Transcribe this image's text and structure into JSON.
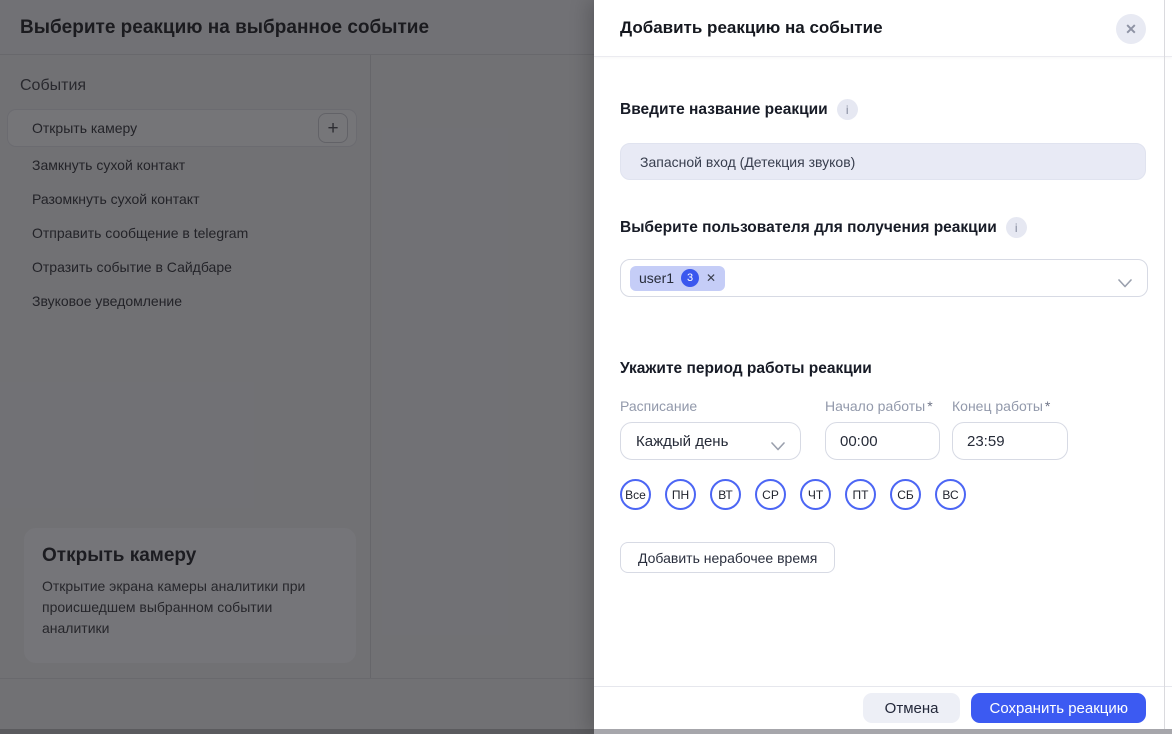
{
  "background": {
    "title": "Выберите реакцию на выбранное событие",
    "events_label": "События",
    "plus_icon": "+",
    "events": [
      "Открыть камеру",
      "Замкнуть сухой контакт",
      "Разомкнуть сухой контакт",
      "Отправить сообщение в telegram",
      "Отразить событие в Сайдбаре",
      "Звуковое уведомление"
    ],
    "selected_event_card": {
      "title": "Открыть камеру",
      "description": "Открытие экрана камеры аналитики при происшедшем выбранном событии аналитики"
    }
  },
  "panel": {
    "title": "Добавить реакцию на событие",
    "close_icon": "✕",
    "name_section": {
      "label": "Введите название реакции",
      "info_icon": "i",
      "value": "Запасной вход (Детекция звуков)"
    },
    "user_section": {
      "label": "Выберите пользователя для получения реакции",
      "info_icon": "i",
      "chip": {
        "name": "user1",
        "count": "3",
        "remove_icon": "✕"
      }
    },
    "period_section": {
      "label": "Укажите период работы реакции",
      "schedule": {
        "label": "Расписание",
        "value": "Каждый день"
      },
      "start": {
        "label": "Начало работы",
        "required_mark": "*",
        "value": "00:00"
      },
      "end": {
        "label": "Конец работы",
        "required_mark": "*",
        "value": "23:59"
      },
      "days": [
        "Все",
        "ПН",
        "ВТ",
        "СР",
        "ЧТ",
        "ПТ",
        "СБ",
        "ВС"
      ],
      "add_downtime_label": "Добавить нерабочее время"
    },
    "footer": {
      "cancel_label": "Отмена",
      "save_label": "Сохранить реакцию"
    }
  },
  "colors": {
    "accent": "#3c5af2",
    "chip_bg": "#c5cdf7",
    "day_border": "#4c66f4",
    "overlay": "rgba(16,16,20,0.57)"
  }
}
